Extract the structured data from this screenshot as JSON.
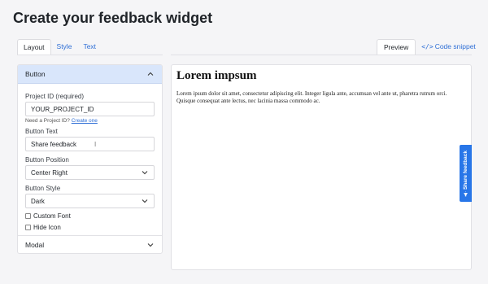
{
  "page": {
    "title": "Create your feedback widget"
  },
  "tabs_left": [
    {
      "label": "Layout",
      "active": true
    },
    {
      "label": "Style",
      "active": false
    },
    {
      "label": "Text",
      "active": false
    }
  ],
  "tabs_right": [
    {
      "label": "Preview",
      "active": true
    },
    {
      "label": "Code snippet",
      "icon": "code-icon",
      "active": false
    }
  ],
  "button_section": {
    "title": "Button",
    "expanded": true,
    "project_id_label": "Project ID (required)",
    "project_id_value": "YOUR_PROJECT_ID",
    "help_text": "Need a Project ID?",
    "help_link": "Create one",
    "button_text_label": "Button Text",
    "button_text_value": "Share feedback",
    "position_label": "Button Position",
    "position_value": "Center Right",
    "style_label": "Button Style",
    "style_value": "Dark",
    "custom_font_label": "Custom Font",
    "custom_font_checked": false,
    "hide_icon_label": "Hide Icon",
    "hide_icon_checked": false
  },
  "modal_section": {
    "title": "Modal",
    "expanded": false
  },
  "preview": {
    "heading": "Lorem impsum",
    "body": "Lorem ipsum dolor sit amet, consectetur adipiscing elit. Integer ligula ante, accumsan vel ante ut, pharetra rutrum orci. Quisque consequat ante lectus, nec lacinia massa commodo ac."
  },
  "widget": {
    "label": "Share feedback",
    "icon": "megaphone-icon",
    "color": "#2876e8"
  },
  "colors": {
    "accent": "#2f6fd6",
    "section_header_bg": "#d9e6fb"
  }
}
